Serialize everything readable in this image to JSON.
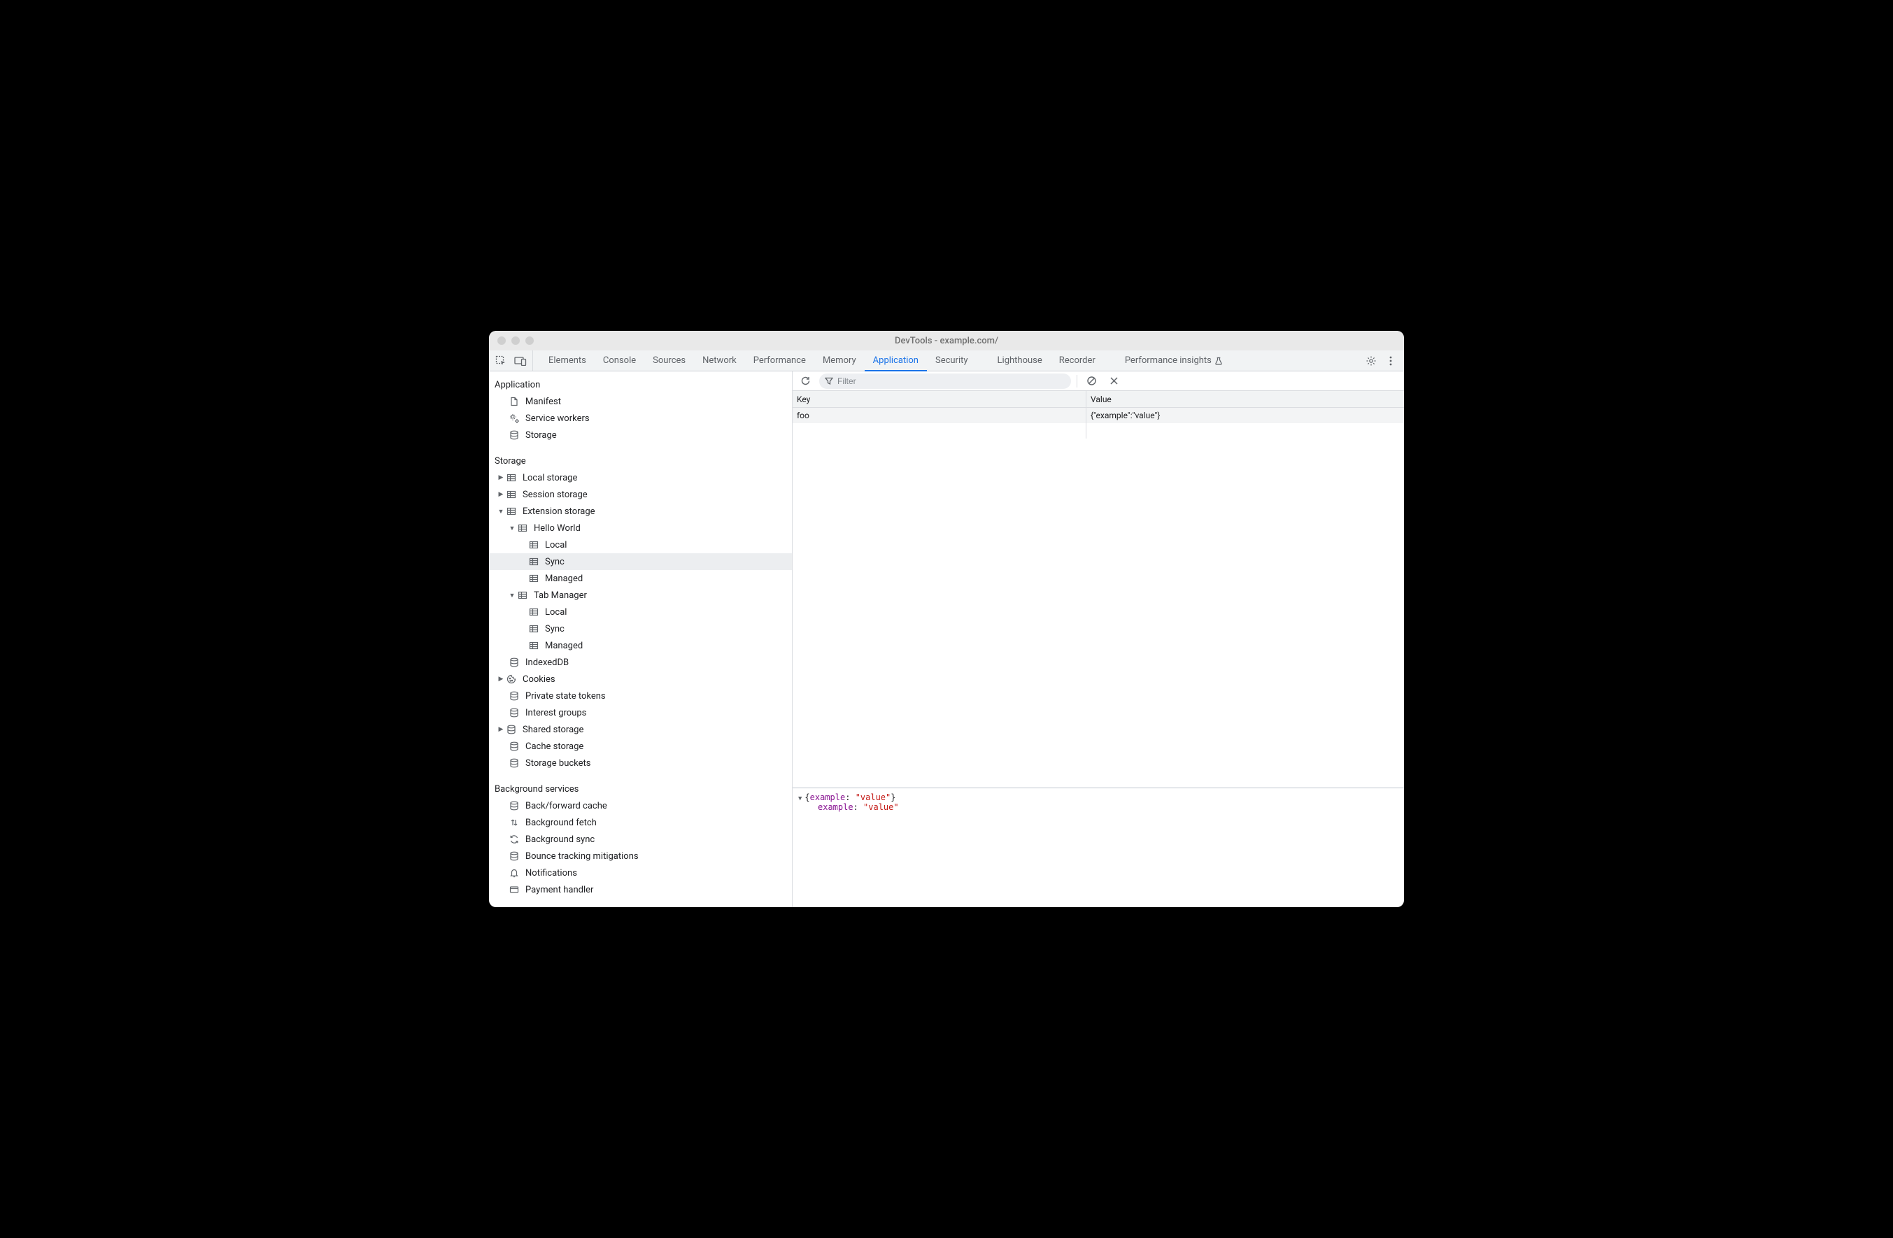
{
  "window": {
    "title": "DevTools - example.com/"
  },
  "tabs": {
    "items": [
      {
        "label": "Elements"
      },
      {
        "label": "Console"
      },
      {
        "label": "Sources"
      },
      {
        "label": "Network"
      },
      {
        "label": "Performance"
      },
      {
        "label": "Memory"
      },
      {
        "label": "Application"
      },
      {
        "label": "Security"
      },
      {
        "label": "Lighthouse"
      },
      {
        "label": "Recorder"
      },
      {
        "label": "Performance insights"
      }
    ],
    "active": "Application"
  },
  "sidebar": {
    "sections": {
      "application": {
        "heading": "Application",
        "items": [
          {
            "label": "Manifest"
          },
          {
            "label": "Service workers"
          },
          {
            "label": "Storage"
          }
        ]
      },
      "storage": {
        "heading": "Storage",
        "local_storage": "Local storage",
        "session_storage": "Session storage",
        "extension_storage": "Extension storage",
        "ext_hello_world": "Hello World",
        "ext_hw_local": "Local",
        "ext_hw_sync": "Sync",
        "ext_hw_managed": "Managed",
        "ext_tab_manager": "Tab Manager",
        "ext_tm_local": "Local",
        "ext_tm_sync": "Sync",
        "ext_tm_managed": "Managed",
        "indexeddb": "IndexedDB",
        "cookies": "Cookies",
        "private_state_tokens": "Private state tokens",
        "interest_groups": "Interest groups",
        "shared_storage": "Shared storage",
        "cache_storage": "Cache storage",
        "storage_buckets": "Storage buckets"
      },
      "background": {
        "heading": "Background services",
        "items": [
          {
            "label": "Back/forward cache"
          },
          {
            "label": "Background fetch"
          },
          {
            "label": "Background sync"
          },
          {
            "label": "Bounce tracking mitigations"
          },
          {
            "label": "Notifications"
          },
          {
            "label": "Payment handler"
          }
        ]
      }
    }
  },
  "filter": {
    "placeholder": "Filter"
  },
  "table": {
    "headers": {
      "key": "Key",
      "value": "Value"
    },
    "rows": [
      {
        "key": "foo",
        "value": "{\"example\":\"value\"}"
      }
    ]
  },
  "preview": {
    "summary_open": "{",
    "summary_key": "example",
    "summary_sep": ": ",
    "summary_val": "\"value\"",
    "summary_close": "}",
    "detail_key": "example",
    "detail_sep": ": ",
    "detail_val": "\"value\""
  }
}
